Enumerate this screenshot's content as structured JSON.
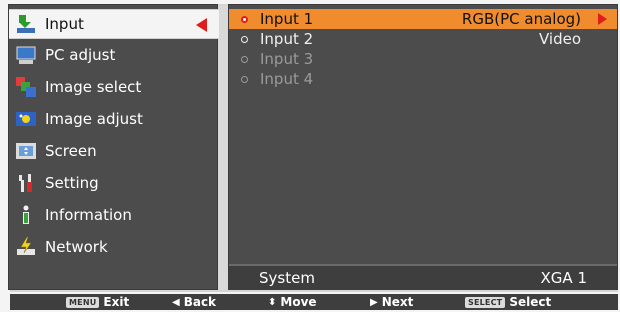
{
  "menu": {
    "items": [
      {
        "label": "Input",
        "icon": "input-icon"
      },
      {
        "label": "PC adjust",
        "icon": "pc-adjust-icon"
      },
      {
        "label": "Image select",
        "icon": "image-select-icon"
      },
      {
        "label": "Image adjust",
        "icon": "image-adjust-icon"
      },
      {
        "label": "Screen",
        "icon": "screen-icon"
      },
      {
        "label": "Setting",
        "icon": "setting-icon"
      },
      {
        "label": "Information",
        "icon": "information-icon"
      },
      {
        "label": "Network",
        "icon": "network-icon"
      }
    ]
  },
  "inputs": [
    {
      "label": "Input 1",
      "value": "RGB(PC analog)"
    },
    {
      "label": "Input 2",
      "value": "Video"
    },
    {
      "label": "Input 3",
      "value": ""
    },
    {
      "label": "Input 4",
      "value": ""
    }
  ],
  "system": {
    "label": "System",
    "value": "XGA 1"
  },
  "guide": {
    "exit_key": "MENU",
    "exit": "Exit",
    "back": "Back",
    "move": "Move",
    "next": "Next",
    "select_key": "SELECT",
    "select": "Select"
  },
  "colors": {
    "highlight": "#f08c2d",
    "accent_red": "#e11c1c",
    "panel": "#4c4c4c"
  }
}
